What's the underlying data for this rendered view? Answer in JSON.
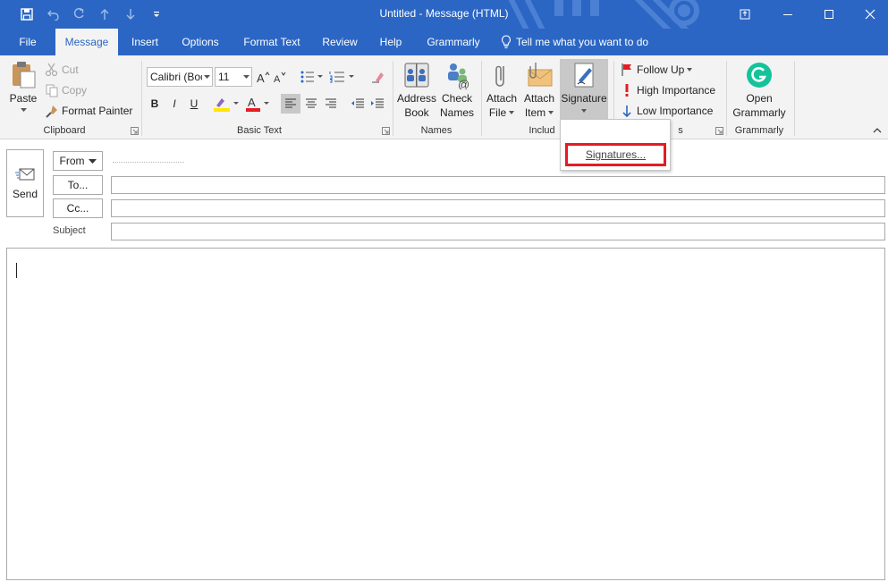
{
  "window": {
    "title": "Untitled - Message (HTML)"
  },
  "tabs": [
    "File",
    "Message",
    "Insert",
    "Options",
    "Format Text",
    "Review",
    "Help",
    "Grammarly"
  ],
  "tell_me": "Tell me what you want to do",
  "clipboard": {
    "paste": "Paste",
    "cut": "Cut",
    "copy": "Copy",
    "format_painter": "Format Painter",
    "label": "Clipboard"
  },
  "basic_text": {
    "font_name": "Calibri (Boc",
    "font_size": "11",
    "bold": "B",
    "italic": "I",
    "underline": "U",
    "label": "Basic Text"
  },
  "names": {
    "address_book_1": "Address",
    "address_book_2": "Book",
    "check_names_1": "Check",
    "check_names_2": "Names",
    "label": "Names"
  },
  "include": {
    "attach_file_1": "Attach",
    "attach_file_2": "File",
    "attach_item_1": "Attach",
    "attach_item_2": "Item",
    "signature": "Signature",
    "label": "Includ"
  },
  "tags": {
    "follow_up": "Follow Up",
    "high_importance": "High Importance",
    "low_importance": "Low Importance",
    "label": "s"
  },
  "grammarly": {
    "open_1": "Open",
    "open_2": "Grammarly",
    "label": "Grammarly"
  },
  "compose": {
    "send": "Send",
    "from": "From",
    "to": "To...",
    "cc": "Cc...",
    "subject": "Subject"
  },
  "signature_menu": {
    "item": "Signatures..."
  },
  "colors": {
    "brand_blue": "#2b66c4",
    "highlight_red": "#e51c23",
    "ribbon_bg": "#f3f3f3"
  }
}
